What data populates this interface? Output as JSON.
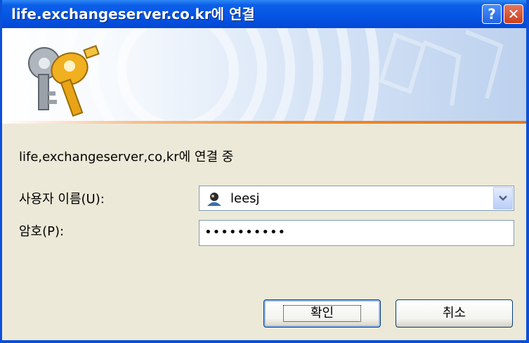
{
  "window": {
    "title": "life.exchangeserver.co.kr에 연결"
  },
  "titlebar": {
    "help": "?",
    "close": "✕"
  },
  "banner": {
    "icon": "keys-icon"
  },
  "form": {
    "connecting_text": "life,exchangeserver,co,kr에 연결 중",
    "username_label": "사용자 이름(U):",
    "username_value": "leesj",
    "password_label": "암호(P):",
    "password_value": "••••••••••"
  },
  "buttons": {
    "ok": "확인",
    "cancel": "취소"
  },
  "colors": {
    "titlebar": "#0554e3",
    "accent_line": "#f08a2c",
    "dialog_bg": "#ece9d8",
    "border": "#0a50d8"
  }
}
